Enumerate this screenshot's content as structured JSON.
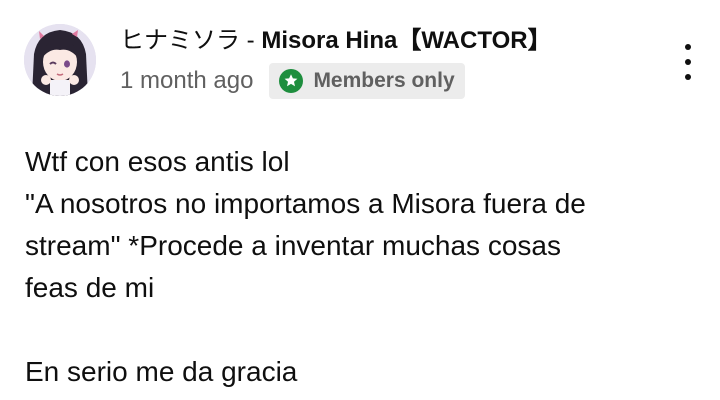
{
  "post": {
    "author_jp": "ヒナミソラ",
    "author_separator": " - ",
    "author_en": "Misora Hina【WACTOR】",
    "timestamp": "1 month ago",
    "badge": {
      "label": "Members only",
      "icon": "star-icon",
      "color": "#1e8e3e"
    },
    "more_icon": "more-vert-icon",
    "body_lines": [
      "Wtf con esos antis lol",
      "\"A nosotros no importamos a Misora fuera de",
      "stream\" *Procede a inventar muchas cosas",
      "feas de mi",
      "En serio me da gracia"
    ]
  }
}
